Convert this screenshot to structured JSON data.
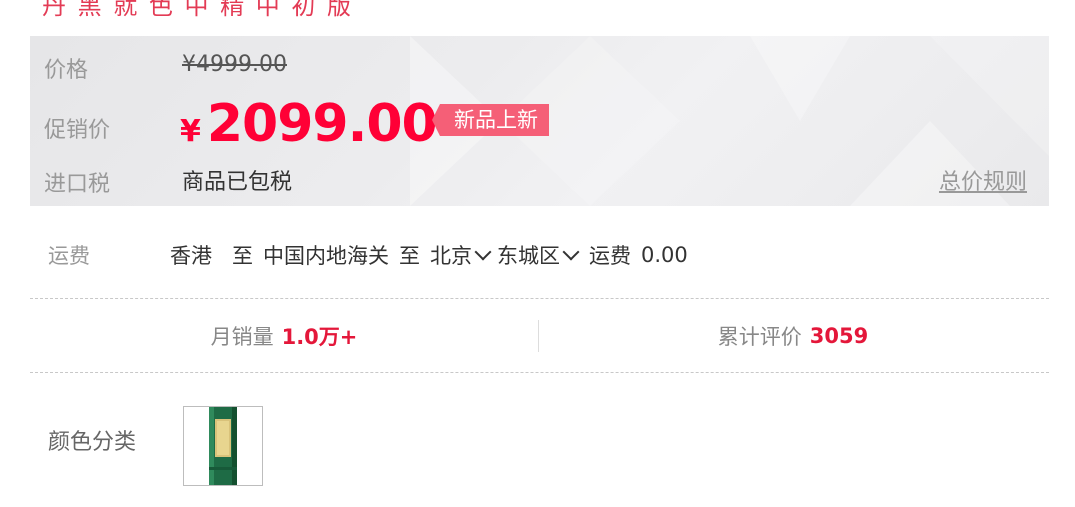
{
  "header_partial": "丹 黑 就 色 中 精 中 初 版",
  "price": {
    "original_label": "价格",
    "original_currency": "¥",
    "original_value": "4999.00",
    "promo_label": "促销价",
    "promo_currency": "¥",
    "promo_value": "2099.00",
    "badge": "新品上新",
    "tax_label": "进口税",
    "tax_value": "商品已包税",
    "rule_link": "总价规则"
  },
  "shipping": {
    "label": "运费",
    "from": "香港",
    "to_word_1": "至",
    "customs": "中国内地海关",
    "to_word_2": "至",
    "city": "北京",
    "district": "东城区",
    "fee_label": "运费",
    "fee_value": "0.00"
  },
  "stats": {
    "monthly_label": "月销量",
    "monthly_value": "1.0万+",
    "reviews_label": "累计评价",
    "reviews_value": "3059"
  },
  "sku": {
    "label": "颜色分类"
  },
  "colors": {
    "promo_red": "#ff0036",
    "badge_pink": "#f55f77",
    "product_green": "#1e6b45"
  }
}
